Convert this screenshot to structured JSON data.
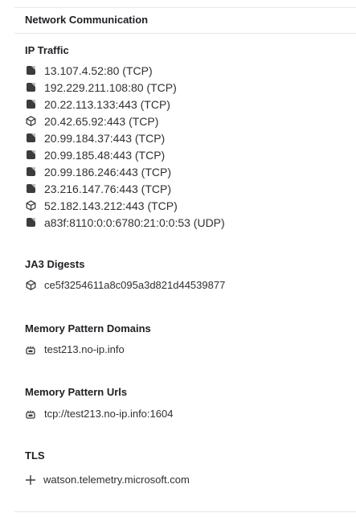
{
  "header": {
    "title": "Network Communication"
  },
  "ip_traffic": {
    "title": "IP Traffic",
    "items": [
      {
        "icon": "file-icon",
        "text": "13.107.4.52:80 (TCP)"
      },
      {
        "icon": "file-icon",
        "text": "192.229.211.108:80 (TCP)"
      },
      {
        "icon": "file-icon",
        "text": "20.22.113.133:443 (TCP)"
      },
      {
        "icon": "cube-icon",
        "text": "20.42.65.92:443 (TCP)"
      },
      {
        "icon": "file-icon",
        "text": "20.99.184.37:443 (TCP)"
      },
      {
        "icon": "file-icon",
        "text": "20.99.185.48:443 (TCP)"
      },
      {
        "icon": "file-icon",
        "text": "20.99.186.246:443 (TCP)"
      },
      {
        "icon": "file-icon",
        "text": "23.216.147.76:443 (TCP)"
      },
      {
        "icon": "cube-icon",
        "text": "52.182.143.212:443 (TCP)"
      },
      {
        "icon": "file-icon",
        "text": "a83f:8110:0:0:6780:21:0:0:53 (UDP)"
      }
    ]
  },
  "ja3": {
    "title": "JA3 Digests",
    "items": [
      {
        "icon": "cube-icon",
        "text": "ce5f3254611a8c095a3d821d44539877"
      }
    ]
  },
  "mem_domains": {
    "title": "Memory Pattern Domains",
    "items": [
      {
        "icon": "memory-icon",
        "text": "test213.no-ip.info"
      }
    ]
  },
  "mem_urls": {
    "title": "Memory Pattern Urls",
    "items": [
      {
        "icon": "memory-icon",
        "text": "tcp://test213.no-ip.info:1604"
      }
    ]
  },
  "tls": {
    "title": "TLS",
    "items": [
      {
        "icon": "plus-icon",
        "text": "watson.telemetry.microsoft.com"
      }
    ]
  }
}
